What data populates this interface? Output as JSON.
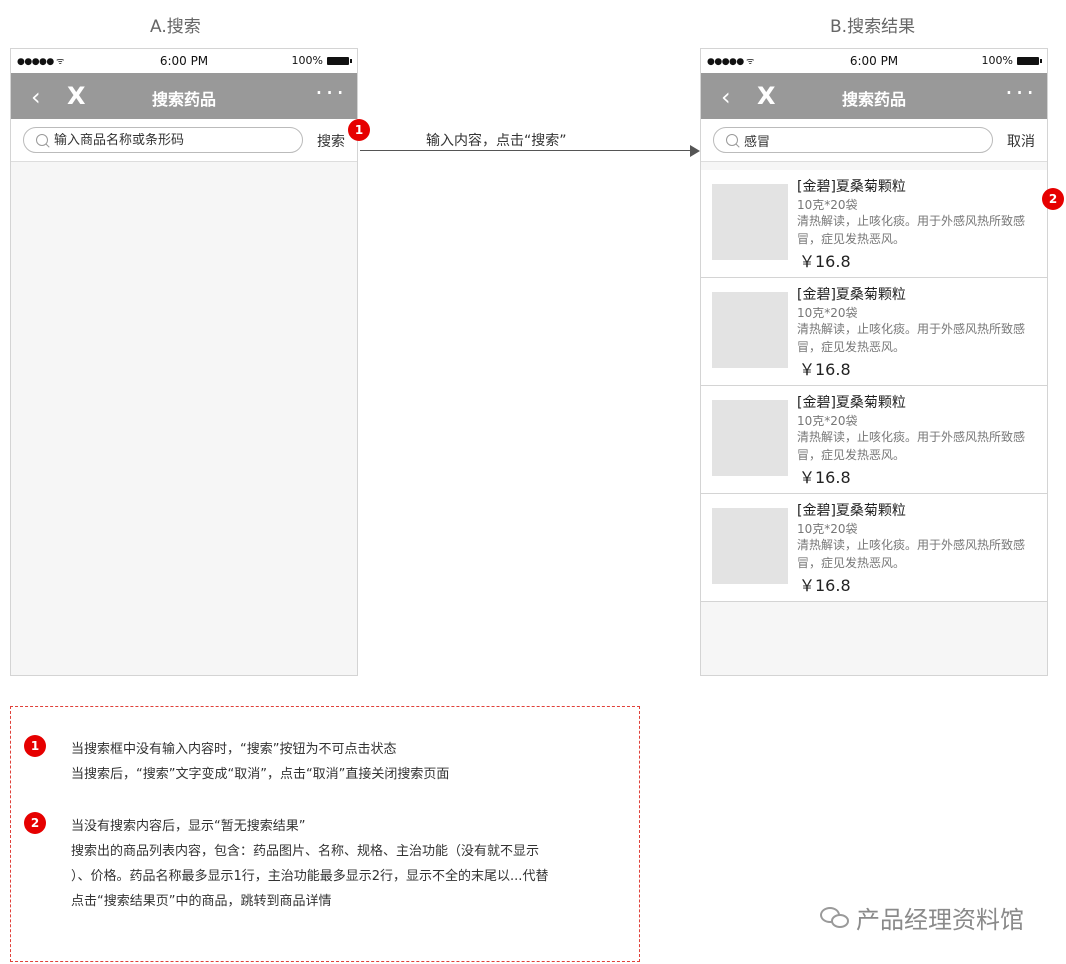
{
  "panels": {
    "a_title": "A.搜索",
    "b_title": "B.搜索结果"
  },
  "status_bar": {
    "signal": "●●●●● ᯤ",
    "time": "6:00 PM",
    "battery": "100%"
  },
  "navbar": {
    "back_icon": "‹",
    "close_icon": "X",
    "title": "搜索药品",
    "more_icon": "···"
  },
  "search_a": {
    "placeholder": "输入商品名称或条形码",
    "button": "搜索"
  },
  "search_b": {
    "value": "感冒",
    "button": "取消"
  },
  "arrow_label": "输入内容，点击“搜索”",
  "badges": {
    "one": "1",
    "two": "2"
  },
  "results": [
    {
      "name": "[金碧]夏桑菊颗粒",
      "spec": "10克*20袋",
      "desc": "清热解读，止咳化痰。用于外感风热所致感冒，症见发热恶风。",
      "price": "￥16.8"
    },
    {
      "name": "[金碧]夏桑菊颗粒",
      "spec": "10克*20袋",
      "desc": "清热解读，止咳化痰。用于外感风热所致感冒，症见发热恶风。",
      "price": "￥16.8"
    },
    {
      "name": "[金碧]夏桑菊颗粒",
      "spec": "10克*20袋",
      "desc": "清热解读，止咳化痰。用于外感风热所致感冒，症见发热恶风。",
      "price": "￥16.8"
    },
    {
      "name": "[金碧]夏桑菊颗粒",
      "spec": "10克*20袋",
      "desc": "清热解读，止咳化痰。用于外感风热所致感冒，症见发热恶风。",
      "price": "￥16.8"
    }
  ],
  "notes": {
    "n1_line1": "当搜索框中没有输入内容时，“搜索”按钮为不可点击状态",
    "n1_line2": "当搜索后，“搜索”文字变成“取消”，点击“取消”直接关闭搜索页面",
    "n2_line1": "当没有搜索内容后，显示“暂无搜索结果”",
    "n2_line2": "搜索出的商品列表内容，包含：药品图片、名称、规格、主治功能（没有就不显示",
    "n2_line3": "）、价格。药品名称最多显示1行，主治功能最多显示2行，显示不全的末尾以...代替",
    "n2_line4": "点击“搜索结果页”中的商品，跳转到商品详情"
  },
  "watermark": "产品经理资料馆"
}
